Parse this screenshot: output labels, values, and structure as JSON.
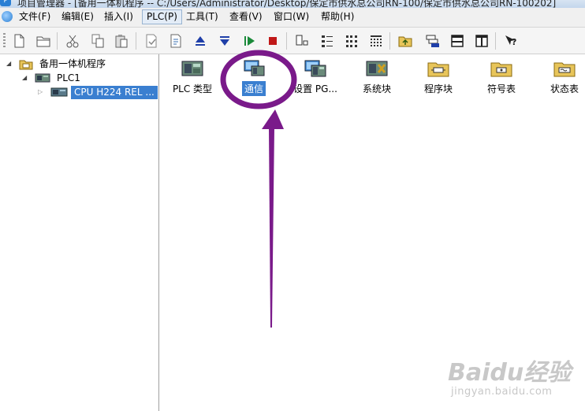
{
  "window": {
    "title": "项目管理器 - [备用一体机程序 -- C:/Users/Administrator/Desktop/保定市供水总公司RN-100/保定市供水总公司RN-100202]"
  },
  "menu": {
    "items": [
      "文件(F)",
      "编辑(E)",
      "插入(I)",
      "PLC(P)",
      "工具(T)",
      "查看(V)",
      "窗口(W)",
      "帮助(H)"
    ],
    "active": "PLC(P)"
  },
  "toolbar": {
    "buttons": [
      "new-file-icon",
      "open-folder-icon",
      "cut-icon",
      "copy-icon",
      "paste-icon",
      "check-icon",
      "compile-icon",
      "upload-icon",
      "download-icon",
      "run-icon",
      "stop-icon",
      "monitor-icon",
      "list-icon",
      "grid-icon",
      "matrix-icon",
      "folder-up-icon",
      "layers-icon",
      "window-h-icon",
      "window-v-icon",
      "help-icon"
    ]
  },
  "tree": {
    "root": "备用一体机程序",
    "plc": "PLC1",
    "cpu": "CPU H224 REL ..."
  },
  "tiles": [
    {
      "label": "PLC 类型",
      "icon": "plc-type-icon"
    },
    {
      "label": "通信",
      "icon": "communication-icon",
      "selected": true
    },
    {
      "label": "设置 PG...",
      "icon": "set-pg-icon"
    },
    {
      "label": "系统块",
      "icon": "system-block-icon"
    },
    {
      "label": "程序块",
      "icon": "program-block-icon"
    },
    {
      "label": "符号表",
      "icon": "symbol-table-icon"
    },
    {
      "label": "状态表",
      "icon": "status-table-icon"
    }
  ],
  "annotation": {
    "color": "#7a1a8a"
  },
  "watermark": {
    "line1": "Baidu经验",
    "line2": "jingyan.baidu.com"
  }
}
